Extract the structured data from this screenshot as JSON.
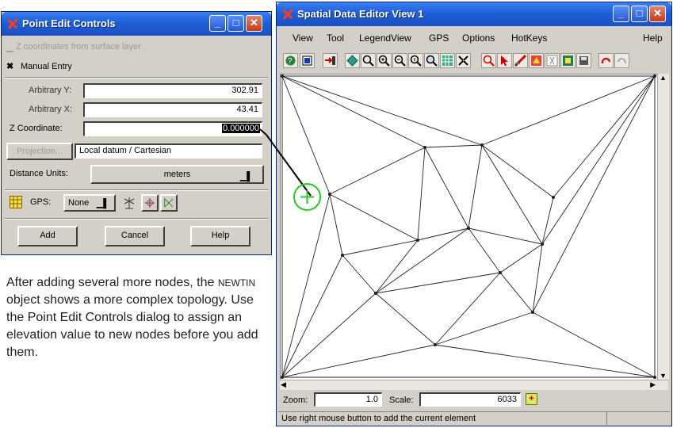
{
  "point_edit": {
    "title": "Point Edit Controls",
    "z_from_surface_label": "Z coordinates from surface layer",
    "manual_entry_label": "Manual Entry",
    "arb_y_label": "Arbitrary Y:",
    "arb_y_value": "302.91",
    "arb_x_label": "Arbitrary X:",
    "arb_x_value": "43.41",
    "z_label": "Z Coordinate:",
    "z_value": "0.000000",
    "projection_label": "Projection...",
    "projection_value": "Local datum / Cartesian",
    "distance_units_label": "Distance Units:",
    "distance_units_value": "meters",
    "gps_label": "GPS:",
    "gps_value": "None",
    "add_label": "Add",
    "cancel_label": "Cancel",
    "help_label": "Help"
  },
  "caption": {
    "before": "After adding several more nodes, the ",
    "object_name": "NEWTIN",
    "after": " object shows a more complex topology. Use the Point Edit Controls dialog to assign an elevation value to new nodes before you add them."
  },
  "editor": {
    "title": "Spatial Data Editor View 1",
    "menu": [
      "View",
      "Tool",
      "LegendView",
      "GPS",
      "Options",
      "HotKeys"
    ],
    "help_menu": "Help",
    "zoom_label": "Zoom:",
    "zoom_value": "1.0",
    "scale_label": "Scale:",
    "scale_value": "6033",
    "status_text": "Use right mouse button to add the current element"
  },
  "colors": {
    "titlebar": "#1f5fd8",
    "window_face": "#d4d0c8",
    "cursor": "#22cc22"
  }
}
